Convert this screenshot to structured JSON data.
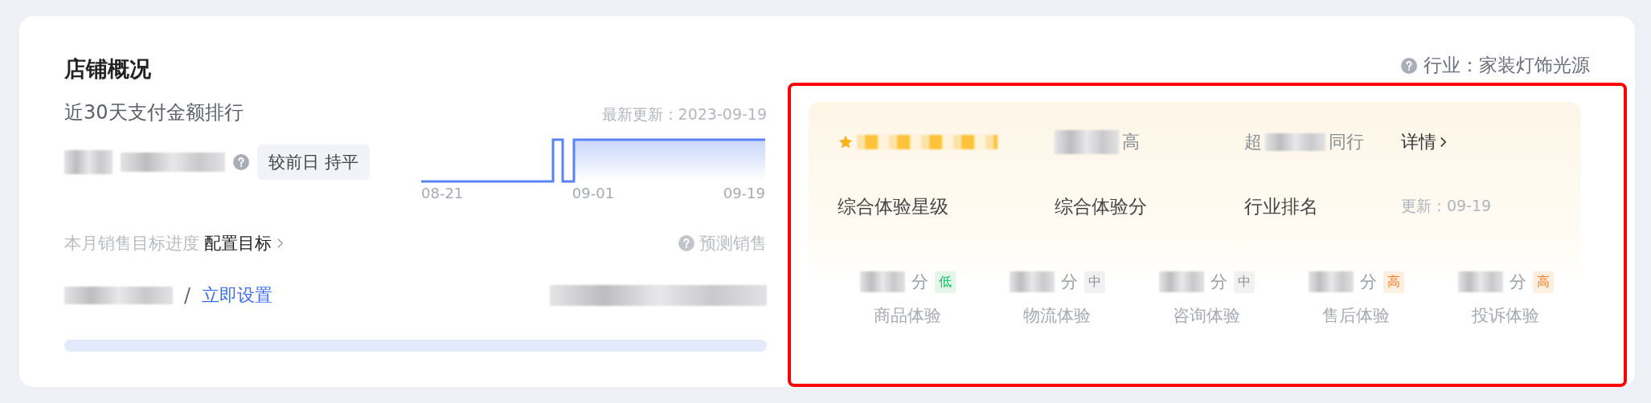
{
  "title": "店铺概况",
  "ranking": {
    "title": "近30天支付金额排行",
    "updated": "最新更新：2023-09-19",
    "compare": "较前日 持平",
    "x_labels": [
      "08-21",
      "09-01",
      "09-19"
    ]
  },
  "target": {
    "label": "本月销售目标进度",
    "link": "配置目标",
    "forecast": "预测销售",
    "separator": "/",
    "action": "立即设置"
  },
  "industry": "行业：家装灯饰光源",
  "experience": {
    "highlighted": true,
    "score_suffix": "高",
    "rank_prefix": "超",
    "rank_suffix": "同行",
    "detail": "详情",
    "labels": [
      "综合体验星级",
      "综合体验分",
      "行业排名"
    ],
    "updated": "更新：09-19",
    "items": [
      {
        "unit": "分",
        "tag": "低",
        "color": "#1fb85a",
        "name": "商品体验"
      },
      {
        "unit": "分",
        "tag": "中",
        "color": "#8a8d94",
        "name": "物流体验"
      },
      {
        "unit": "分",
        "tag": "中",
        "color": "#8a8d94",
        "name": "咨询体验"
      },
      {
        "unit": "分",
        "tag": "高",
        "color": "#f77b1c",
        "name": "售后体验"
      },
      {
        "unit": "分",
        "tag": "高",
        "color": "#f77b1c",
        "name": "投诉体验"
      }
    ]
  }
}
